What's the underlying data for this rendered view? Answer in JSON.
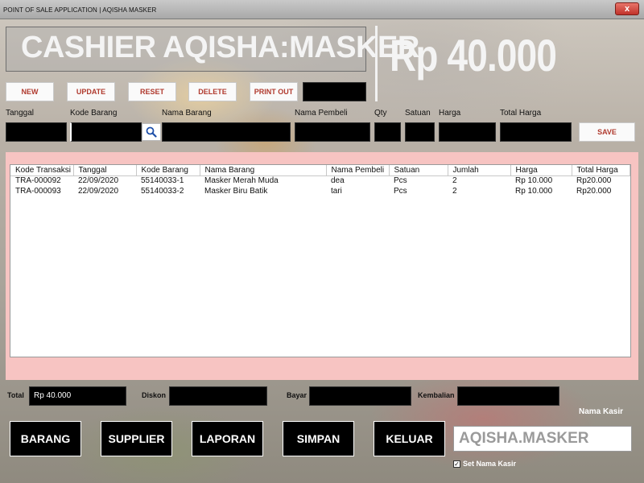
{
  "window": {
    "title": "POINT OF SALE APPLICATION |  AQISHA MASKER",
    "close_label": "x"
  },
  "header": {
    "banner": "CASHIER AQISHA:MASKER",
    "total_display": "Rp 40.000"
  },
  "toolbar": {
    "new": "NEW",
    "update": "UPDATE",
    "reset": "RESET",
    "delete": "DELETE",
    "print": "PRINT OUT"
  },
  "form": {
    "labels": {
      "tanggal": "Tanggal",
      "kode_barang": "Kode Barang",
      "nama_barang": "Nama Barang",
      "nama_pembeli": "Nama Pembeli",
      "qty": "Qty",
      "satuan": "Satuan",
      "harga": "Harga",
      "total_harga": "Total Harga"
    },
    "values": {
      "tanggal": "",
      "kode_barang": "",
      "nama_barang": "",
      "nama_pembeli": "",
      "qty": "",
      "satuan": "",
      "harga": "",
      "total_harga": ""
    },
    "save": "SAVE"
  },
  "table": {
    "columns": [
      "Kode Transaksi",
      "Tanggal",
      "Kode Barang",
      "Nama Barang",
      "Nama Pembeli",
      "Satuan",
      "Jumlah",
      "Harga",
      "Total Harga"
    ],
    "rows": [
      [
        "TRA-000092",
        "22/09/2020",
        "55140033-1",
        "Masker Merah Muda",
        "dea",
        "Pcs",
        "2",
        "Rp 10.000",
        "Rp20.000"
      ],
      [
        "TRA-000093",
        "22/09/2020",
        "55140033-2",
        "Masker Biru Batik",
        "tari",
        "Pcs",
        "2",
        "Rp 10.000",
        "Rp20.000"
      ]
    ]
  },
  "footer": {
    "total_label": "Total",
    "total_value": "Rp 40.000",
    "diskon_label": "Diskon",
    "diskon_value": "",
    "bayar_label": "Bayar",
    "bayar_value": "",
    "kembalian_label": "Kembalian",
    "kembalian_value": ""
  },
  "nav": {
    "barang": "BARANG",
    "supplier": "SUPPLIER",
    "laporan": "LAPORAN",
    "simpan": "SIMPAN",
    "keluar": "KELUAR"
  },
  "kasir": {
    "label": "Nama Kasir",
    "value": "AQISHA.MASKER",
    "checkbox_label": "Set Nama Kasir",
    "checked": true
  },
  "colors": {
    "accent_text": "#b03a2e",
    "panel_bg": "#f7c4c2",
    "field_bg": "#000000"
  },
  "icons": {
    "search": "search-icon",
    "close": "close-icon"
  }
}
